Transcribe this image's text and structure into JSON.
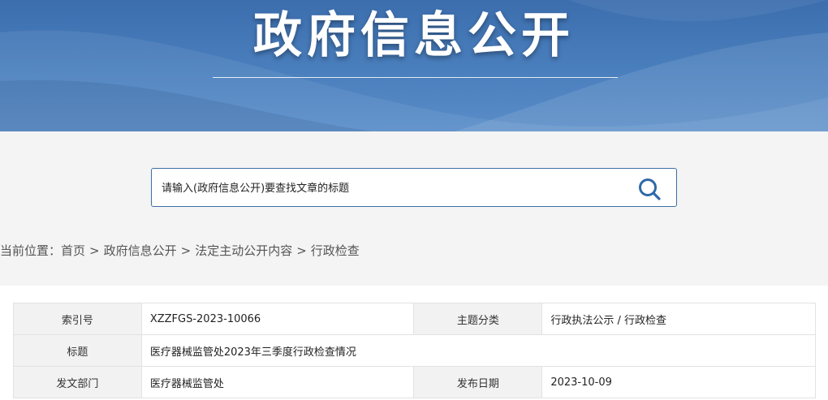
{
  "banner": {
    "title": "政府信息公开"
  },
  "search": {
    "placeholder": "请输入(政府信息公开)要查找文章的标题",
    "icon": "search-icon"
  },
  "breadcrumb": {
    "prefix": "当前位置：",
    "items": [
      "首页",
      "政府信息公开",
      "法定主动公开内容",
      "行政检查"
    ],
    "separator": ">"
  },
  "info_table": {
    "rows": [
      {
        "label1": "索引号",
        "value1": "XZZFGS-2023-10066",
        "label2": "主题分类",
        "value2": "行政执法公示 / 行政检查"
      },
      {
        "label1": "标题",
        "value1": "医疗器械监管处2023年三季度行政检查情况"
      },
      {
        "label1": "发文部门",
        "value1": "医疗器械监管处",
        "label2": "发布日期",
        "value2": "2023-10-09"
      }
    ]
  },
  "colors": {
    "banner_blue": "#4a7fbd",
    "search_border": "#3d6fa9",
    "icon_blue": "#2f6aa8",
    "page_gray": "#f4f4f4"
  }
}
